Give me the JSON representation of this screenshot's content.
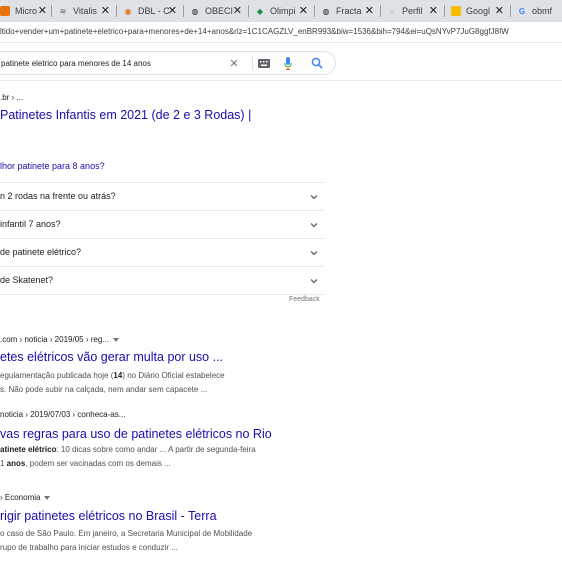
{
  "tabs": [
    {
      "title": "Micro",
      "fav_color": "#e8710a",
      "fav_glyph": "■"
    },
    {
      "title": "Vitalis",
      "fav_color": "#5f6368",
      "fav_glyph": "≋"
    },
    {
      "title": "DBL - C",
      "fav_color": "#e8710a",
      "fav_glyph": "◉"
    },
    {
      "title": "OBECI",
      "fav_color": "#202124",
      "fav_glyph": "◍"
    },
    {
      "title": "Olimpi",
      "fav_color": "#1e8e3e",
      "fav_glyph": "◆"
    },
    {
      "title": "Fracta",
      "fav_color": "#202124",
      "fav_glyph": "◍"
    },
    {
      "title": "Perfil",
      "fav_color": "#9aa0a6",
      "fav_glyph": "○"
    },
    {
      "title": "Googl",
      "fav_color": "#fbbc04",
      "fav_glyph": "■"
    },
    {
      "title": "obmf",
      "fav_color": "#4285f4",
      "fav_glyph": "G"
    }
  ],
  "address_bar": {
    "url": "ltido+vender+um+patinete+eletrico+para+menores+de+14+anos&rlz=1C1CAGZLV_enBR993&biw=1536&bih=794&ei=uQsNYvP7JuG8ggfJ8IW"
  },
  "search": {
    "query": "patinete eletrico para menores de 14 anos"
  },
  "results_top": {
    "cite": ".br › ...",
    "title": "Patinetes Infantis em 2021 (de 2 e 3 Rodas) |"
  },
  "paa": {
    "heading_link": "lhor patinete para 8 anos?",
    "questions": [
      "n 2 rodas na frente ou atrás?",
      "infantil 7 anos?",
      "de patinete elétrico?",
      "de Skatenet?"
    ],
    "feedback": "Feedback"
  },
  "results": [
    {
      "cite": ".com › noticia › 2019/05 › reg...",
      "has_menu": true,
      "title": "etes elétricos vão gerar multa por uso ...",
      "snippet_1_pre": "egulamentação publicada hoje (",
      "snippet_1_bold": "14",
      "snippet_1_post": ") no Diário Oficial estabelece",
      "snippet_2": "s. Não pode subir na calçada, nem andar sem capacete ..."
    },
    {
      "cite": "noticia › 2019/07/03 › conheca-as...",
      "has_menu": false,
      "title": "vas regras para uso de patinetes elétricos no Rio",
      "snippet_1_pre": "",
      "snippet_1_bold": "atinete elétrico",
      "snippet_1_post": ": 10 dicas sobre como andar ... A partir de segunda-feira",
      "snippet_2_pre": "1 ",
      "snippet_2_bold": "anos",
      "snippet_2_post": ", podem ser vacinadas com os demais ..."
    },
    {
      "cite": "› Economia",
      "has_menu": true,
      "title": "rigir patinetes elétricos no Brasil - Terra",
      "snippet_1_pre": "o caso de São Paulo. Em janeiro, a Secretaria Municipal de Mobilidade",
      "snippet_1_bold": "",
      "snippet_1_post": "",
      "snippet_2": "rupo de trabalho para iniciar estudos e conduzir ..."
    }
  ]
}
